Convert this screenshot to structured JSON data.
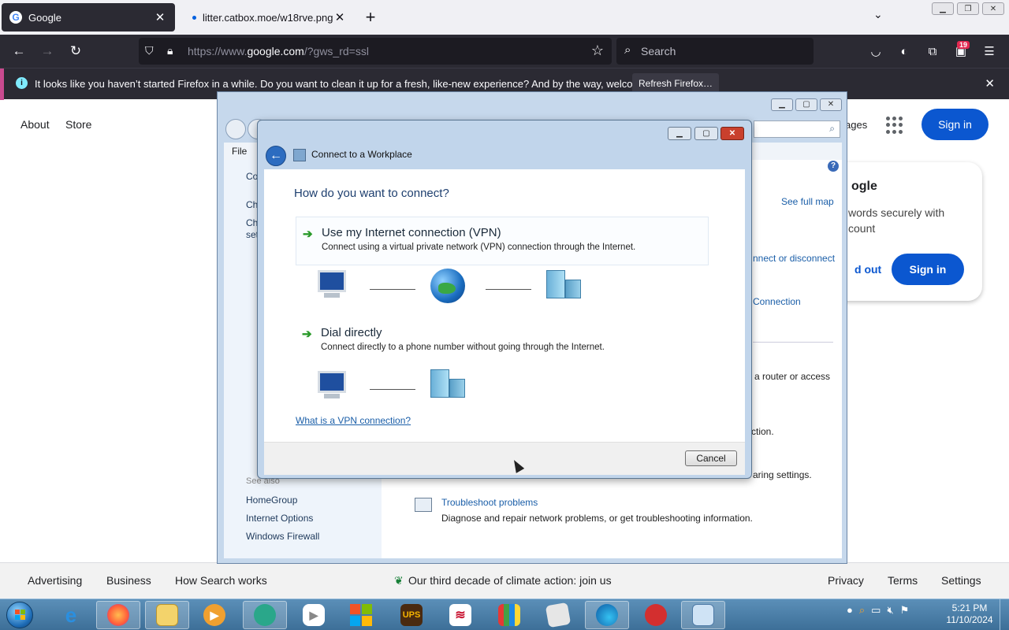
{
  "browser": {
    "tabs": [
      {
        "label": "Google",
        "favicon": "G"
      },
      {
        "label": "litter.catbox.moe/w18rve.png"
      }
    ],
    "url_prefix": "https://www.",
    "url_host": "google.com",
    "url_path": "/?gws_rd=ssl",
    "search_placeholder": "Search",
    "extension_badge": "19",
    "notification": {
      "message": "It looks like you haven’t started Firefox in a while. Do you want to clean it up for a fresh, like-new experience? And by the way, welcome back!",
      "button": "Refresh Firefox…"
    }
  },
  "google": {
    "nav_left": [
      "About",
      "Store"
    ],
    "images_partial": "ages",
    "sign_in": "Sign in",
    "card": {
      "title_partial": "ogle",
      "body_partial": "words securely with\ncount",
      "signout_partial": "d out",
      "sign_in": "Sign in"
    },
    "footer_left": [
      "Advertising",
      "Business",
      "How Search works"
    ],
    "footer_center": "Our third decade of climate action: join us",
    "footer_right": [
      "Privacy",
      "Terms",
      "Settings"
    ]
  },
  "control_panel": {
    "menu_file": "File",
    "left_partial": [
      "Co",
      "Ch",
      "Ch",
      "set"
    ],
    "see_also": "See also",
    "see_also_items": [
      "HomeGroup",
      "Internet Options",
      "Windows Firewall"
    ],
    "right_links": [
      "See full map",
      "nnect or disconnect",
      "Connection"
    ],
    "right_texts": [
      "a router or access",
      "ction.",
      "aring settings."
    ],
    "troubleshoot_link": "Troubleshoot problems",
    "troubleshoot_desc": "Diagnose and repair network problems, or get troubleshooting information."
  },
  "dialog": {
    "title": "Connect to a Workplace",
    "question": "How do you want to connect?",
    "options": [
      {
        "heading": "Use my Internet connection (VPN)",
        "desc": "Connect using a virtual private network (VPN) connection through the Internet."
      },
      {
        "heading": "Dial directly",
        "desc": "Connect directly to a phone number without going through the Internet."
      }
    ],
    "vpn_link": "What is a VPN connection?",
    "cancel": "Cancel"
  },
  "taskbar": {
    "time": "5:21 PM",
    "date": "11/10/2024",
    "apps": [
      "internet-explorer-icon",
      "firefox-icon",
      "file-explorer-icon",
      "media-player-icon",
      "app-icon",
      "youtube-icon",
      "microsoft-store-icon",
      "ups-icon",
      "bank-of-america-icon",
      "shopping-bag-icon",
      "blank-app-icon",
      "edge-icon",
      "angry-birds-icon",
      "control-panel-icon"
    ]
  },
  "colors": {
    "firefox_dark": "#2b2a33",
    "google_blue": "#0b57d0",
    "win7_taskbar": "#3d6f98"
  }
}
